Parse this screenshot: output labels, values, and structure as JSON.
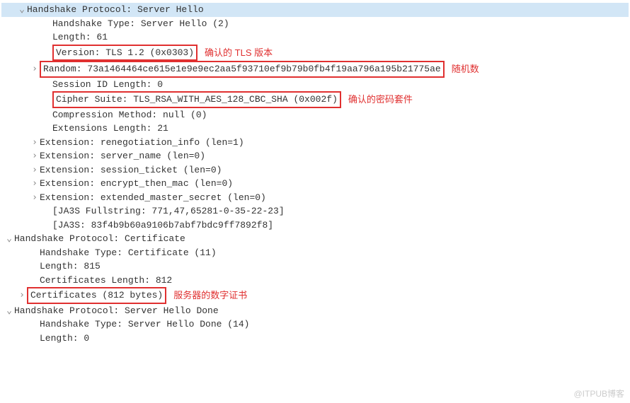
{
  "watermark": "@ITPUB博客",
  "annotations": {
    "version": "确认的 TLS 版本",
    "random": "随机数",
    "cipher": "确认的密码套件",
    "cert": "服务器器的数字证书"
  },
  "server_hello": {
    "header": "Handshake Protocol: Server Hello",
    "type_line": "Handshake Type: Server Hello (2)",
    "length_line": "Length: 61",
    "version_line": "Version: TLS 1.2 (0x0303)",
    "random_line": "Random: 73a1464464ce615e1e9e9ec2aa5f93710ef9b79b0fb4f19aa796a195b21775ae",
    "session_id_line": "Session ID Length: 0",
    "cipher_line": "Cipher Suite: TLS_RSA_WITH_AES_128_CBC_SHA (0x002f)",
    "compression_line": "Compression Method: null (0)",
    "ext_len_line": "Extensions Length: 21",
    "ext1": "Extension: renegotiation_info (len=1)",
    "ext2": "Extension: server_name (len=0)",
    "ext3": "Extension: session_ticket (len=0)",
    "ext4": "Extension: encrypt_then_mac (len=0)",
    "ext5": "Extension: extended_master_secret (len=0)",
    "ja3s_full": "[JA3S Fullstring: 771,47,65281-0-35-22-23]",
    "ja3s": "[JA3S: 83f4b9b60a9106b7abf7bdc9ff7892f8]"
  },
  "certificate": {
    "header": "Handshake Protocol: Certificate",
    "type_line": "Handshake Type: Certificate (11)",
    "length_line": "Length: 815",
    "certs_len_line": "Certificates Length: 812",
    "certs_line": "Certificates (812 bytes)",
    "cert_annot": "服务器的数字证书"
  },
  "hello_done": {
    "header": "Handshake Protocol: Server Hello Done",
    "type_line": "Handshake Type: Server Hello Done (14)",
    "length_line": "Length: 0"
  }
}
